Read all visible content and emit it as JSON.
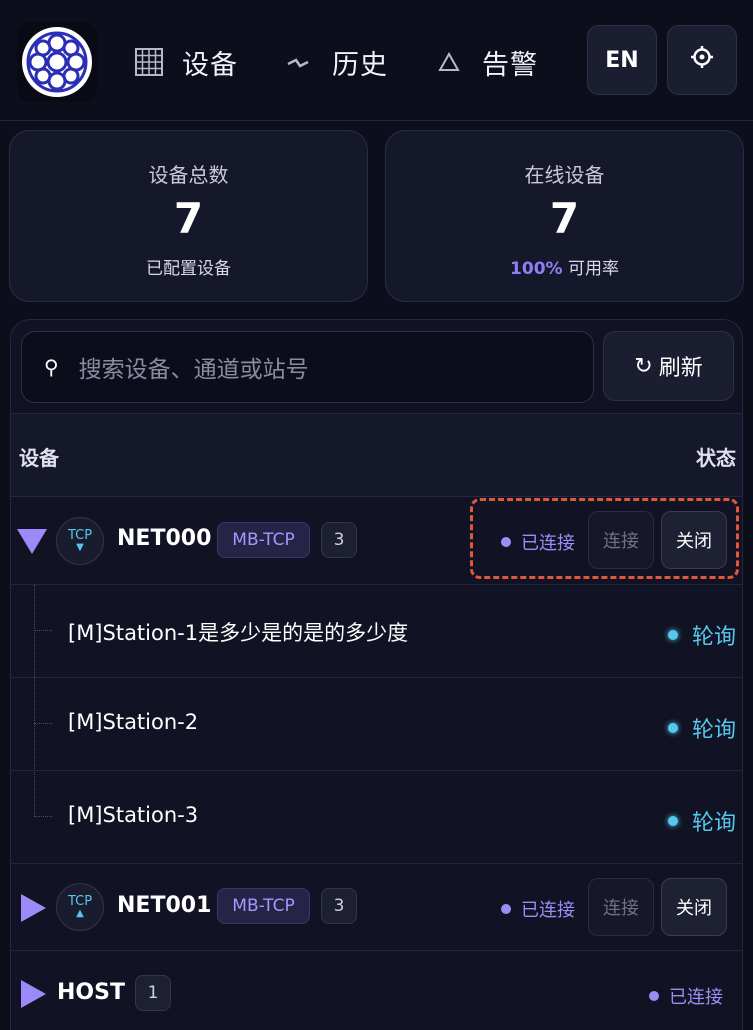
{
  "header": {
    "nav": [
      {
        "icon": "grid-icon",
        "label": "设备"
      },
      {
        "icon": "pulse-icon",
        "label": "历史"
      },
      {
        "icon": "warning-icon",
        "label": "告警"
      }
    ],
    "lang_label": "EN",
    "settings_icon": "gear-icon"
  },
  "stats": {
    "total": {
      "title": "设备总数",
      "value": "7",
      "sub": "已配置设备"
    },
    "online": {
      "title": "在线设备",
      "value": "7",
      "pct": "100%",
      "sub": "可用率"
    }
  },
  "search": {
    "placeholder": "搜索设备、通道或站号"
  },
  "refresh_label": "刷新",
  "table": {
    "col_device": "设备",
    "col_status": "状态"
  },
  "devices": [
    {
      "name": "NET000",
      "proto": "TCP",
      "proto_dir": "▼",
      "tag": "MB-TCP",
      "count": "3",
      "status": "已连接",
      "connect_label": "连接",
      "close_label": "关闭",
      "expanded": true
    },
    {
      "name": "NET001",
      "proto": "TCP",
      "proto_dir": "▲",
      "tag": "MB-TCP",
      "count": "3",
      "status": "已连接",
      "connect_label": "连接",
      "close_label": "关闭",
      "expanded": false
    },
    {
      "name": "HOST",
      "count": "1",
      "status": "已连接",
      "expanded": false
    }
  ],
  "stations": [
    {
      "label": "[M]Station-1是多少是的是的多少度",
      "status": "轮询"
    },
    {
      "label": "[M]Station-2",
      "status": "轮询"
    },
    {
      "label": "[M]Station-3",
      "status": "轮询"
    }
  ],
  "colors": {
    "accent": "#9c8df6",
    "poll": "#55c8ec",
    "highlight": "#e0573c",
    "bg": "#0c0d1a"
  }
}
